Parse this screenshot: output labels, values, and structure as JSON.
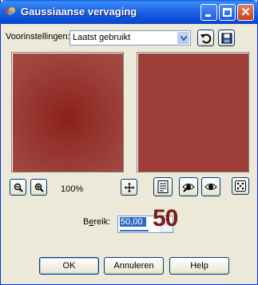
{
  "window": {
    "title": "Gaussiaanse vervaging"
  },
  "presets": {
    "label": "Voorinstellingen:",
    "selected": "Laatst gebruikt"
  },
  "preview": {
    "zoom_level": "100%"
  },
  "radius": {
    "label_prefix": "B",
    "label_accel": "e",
    "label_suffix": "reik:",
    "value": "50,00",
    "overlay_number": "50"
  },
  "buttons": {
    "ok": "OK",
    "cancel": "Annuleren",
    "help": "Help"
  },
  "colors": {
    "preview": "#9c3e37",
    "accent": "#0a5fe8"
  },
  "icons": [
    "app-icon",
    "minimize-icon",
    "maximize-icon",
    "close-icon",
    "dropdown-arrow-icon",
    "reset-icon",
    "save-icon",
    "zoom-out-icon",
    "zoom-in-icon",
    "move-icon",
    "proof-icon",
    "auto-proof-icon",
    "eye-icon",
    "dice-icon"
  ]
}
